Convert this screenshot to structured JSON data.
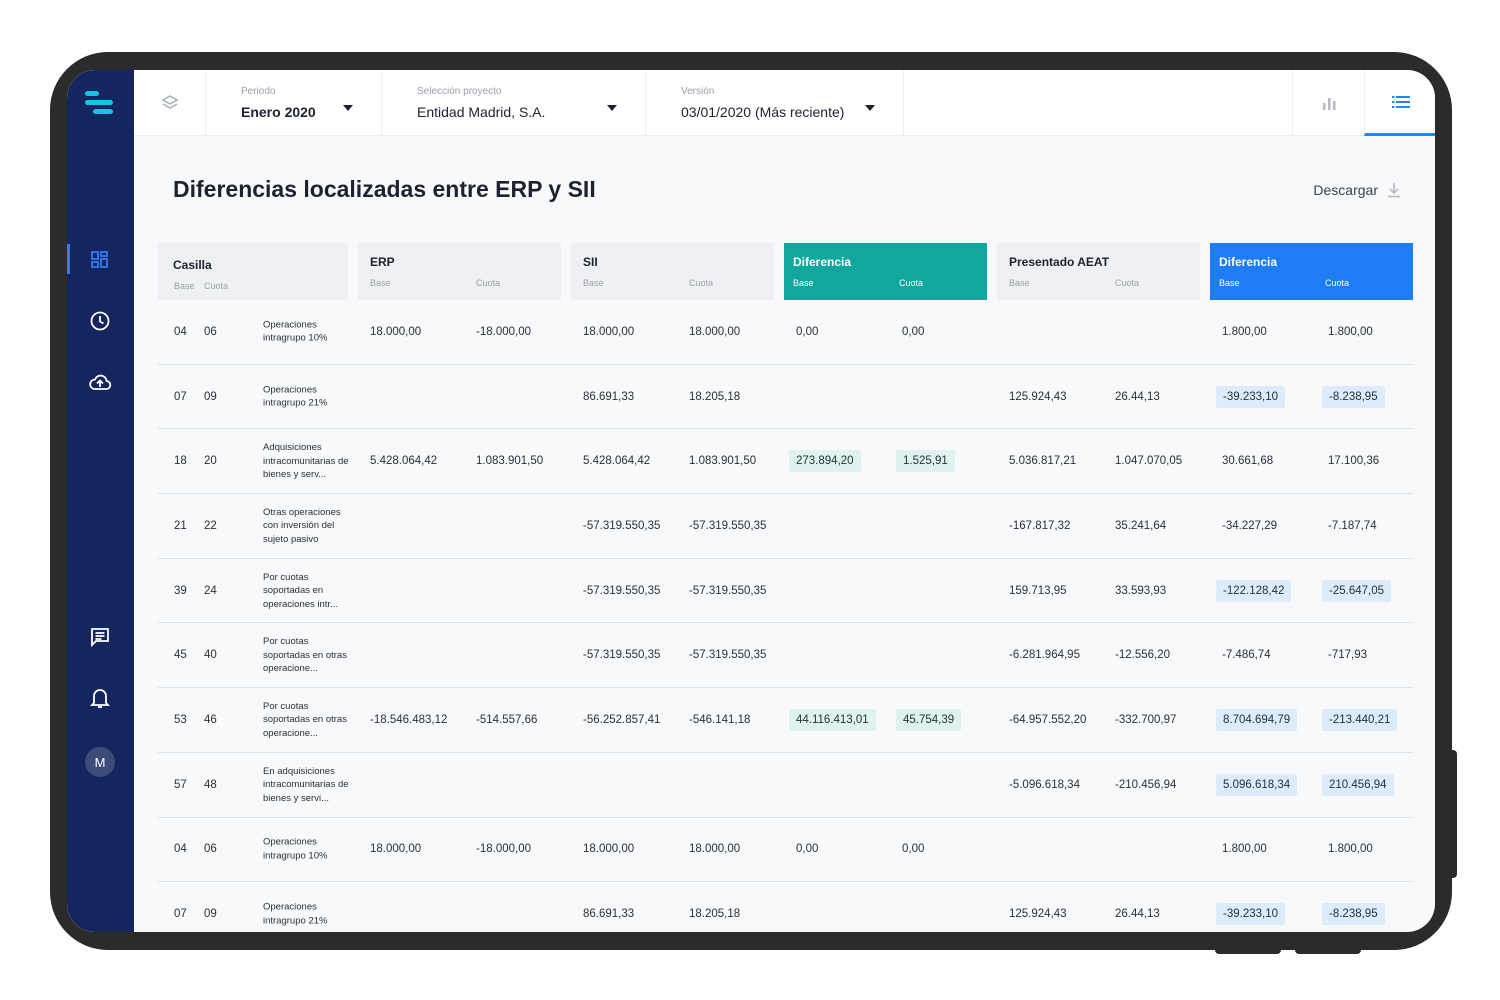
{
  "sidebar": {
    "nav_icons": [
      "dashboard-icon",
      "clock-icon",
      "cloud-upload-icon",
      "chat-icon",
      "bell-icon"
    ],
    "avatar_initial": "M",
    "accent_color": "#17c3e0",
    "active_color": "#2d7df6"
  },
  "topbar": {
    "periodo": {
      "label": "Periodo",
      "value": "Enero 2020"
    },
    "proyecto": {
      "label": "Selección proyecto",
      "value": "Entidad Madrid, S.A."
    },
    "version": {
      "label": "Versión",
      "value": "03/01/2020 (Más reciente)"
    }
  },
  "page": {
    "title": "Diferencias localizadas entre ERP y SII",
    "download_label": "Descargar"
  },
  "table": {
    "headers": {
      "casilla": {
        "title": "Casilla",
        "sub1": "Base",
        "sub2": "Cuota"
      },
      "erp": {
        "title": "ERP",
        "sub1": "Base",
        "sub2": "Cuota"
      },
      "sii": {
        "title": "SII",
        "sub1": "Base",
        "sub2": "Cuota"
      },
      "dif1": {
        "title": "Diferencia",
        "sub1": "Base",
        "sub2": "Cuota"
      },
      "aeat": {
        "title": "Presentado AEAT",
        "sub1": "Base",
        "sub2": "Cuota"
      },
      "dif2": {
        "title": "Diferencia",
        "sub1": "Base",
        "sub2": "Cuota"
      }
    },
    "rows": [
      {
        "base": "04",
        "cuota": "06",
        "desc": "Operaciones intragrupo 10%",
        "erp_b": "18.000,00",
        "erp_c": "-18.000,00",
        "sii_b": "18.000,00",
        "sii_c": "18.000,00",
        "d1_b": "0,00",
        "d1_c": "0,00",
        "d1_hl": false,
        "ae_b": "",
        "ae_c": "",
        "d2_b": "1.800,00",
        "d2_c": "1.800,00",
        "d2_hl": false
      },
      {
        "base": "07",
        "cuota": "09",
        "desc": "Operaciones intragrupo 21%",
        "erp_b": "",
        "erp_c": "",
        "sii_b": "86.691,33",
        "sii_c": "18.205,18",
        "d1_b": "",
        "d1_c": "",
        "d1_hl": false,
        "ae_b": "125.924,43",
        "ae_c": "26.44,13",
        "d2_b": "-39.233,10",
        "d2_c": "-8.238,95",
        "d2_hl": true
      },
      {
        "base": "18",
        "cuota": "20",
        "desc": "Adquisiciones intracomunitarias de bienes y serv...",
        "erp_b": "5.428.064,42",
        "erp_c": "1.083.901,50",
        "sii_b": "5.428.064,42",
        "sii_c": "1.083.901,50",
        "d1_b": "273.894,20",
        "d1_c": "1.525,91",
        "d1_hl": true,
        "ae_b": "5.036.817,21",
        "ae_c": "1.047.070,05",
        "d2_b": "30.661,68",
        "d2_c": "17.100,36",
        "d2_hl": false
      },
      {
        "base": "21",
        "cuota": "22",
        "desc": "Otras operaciones con inversión del sujeto pasivo",
        "erp_b": "",
        "erp_c": "",
        "sii_b": "-57.319.550,35",
        "sii_c": "-57.319.550,35",
        "d1_b": "",
        "d1_c": "",
        "d1_hl": false,
        "ae_b": "-167.817,32",
        "ae_c": "35.241,64",
        "d2_b": "-34.227,29",
        "d2_c": "-7.187,74",
        "d2_hl": false
      },
      {
        "base": "39",
        "cuota": "24",
        "desc": "Por cuotas soportadas en operaciones intr...",
        "erp_b": "",
        "erp_c": "",
        "sii_b": "-57.319.550,35",
        "sii_c": "-57.319.550,35",
        "d1_b": "",
        "d1_c": "",
        "d1_hl": false,
        "ae_b": "159.713,95",
        "ae_c": "33.593,93",
        "d2_b": "-122.128,42",
        "d2_c": "-25.647,05",
        "d2_hl": true
      },
      {
        "base": "45",
        "cuota": "40",
        "desc": "Por cuotas soportadas en otras operacione...",
        "erp_b": "",
        "erp_c": "",
        "sii_b": "-57.319.550,35",
        "sii_c": "-57.319.550,35",
        "d1_b": "",
        "d1_c": "",
        "d1_hl": false,
        "ae_b": "-6.281.964,95",
        "ae_c": "-12.556,20",
        "d2_b": "-7.486,74",
        "d2_c": "-717,93",
        "d2_hl": false
      },
      {
        "base": "53",
        "cuota": "46",
        "desc": "Por cuotas soportadas en otras operacione...",
        "erp_b": "-18.546.483,12",
        "erp_c": "-514.557,66",
        "sii_b": "-56.252.857,41",
        "sii_c": "-546.141,18",
        "d1_b": "44.116.413,01",
        "d1_c": "45.754,39",
        "d1_hl": true,
        "ae_b": "-64.957.552,20",
        "ae_c": "-332.700,97",
        "d2_b": "8.704.694,79",
        "d2_c": "-213.440,21",
        "d2_hl": true
      },
      {
        "base": "57",
        "cuota": "48",
        "desc": "En adquisiciones intracomunitarias de bienes y servi...",
        "erp_b": "",
        "erp_c": "",
        "sii_b": "",
        "sii_c": "",
        "d1_b": "",
        "d1_c": "",
        "d1_hl": false,
        "ae_b": "-5.096.618,34",
        "ae_c": "-210.456,94",
        "d2_b": "5.096.618,34",
        "d2_c": "210.456,94",
        "d2_hl": true
      },
      {
        "base": "04",
        "cuota": "06",
        "desc": "Operaciones intragrupo 10%",
        "erp_b": "18.000,00",
        "erp_c": "-18.000,00",
        "sii_b": "18.000,00",
        "sii_c": "18.000,00",
        "d1_b": "0,00",
        "d1_c": "0,00",
        "d1_hl": false,
        "ae_b": "",
        "ae_c": "",
        "d2_b": "1.800,00",
        "d2_c": "1.800,00",
        "d2_hl": false
      },
      {
        "base": "07",
        "cuota": "09",
        "desc": "Operaciones intragrupo 21%",
        "erp_b": "",
        "erp_c": "",
        "sii_b": "86.691,33",
        "sii_c": "18.205,18",
        "d1_b": "",
        "d1_c": "",
        "d1_hl": false,
        "ae_b": "125.924,43",
        "ae_c": "26.44,13",
        "d2_b": "-39.233,10",
        "d2_c": "-8.238,95",
        "d2_hl": true
      }
    ]
  }
}
